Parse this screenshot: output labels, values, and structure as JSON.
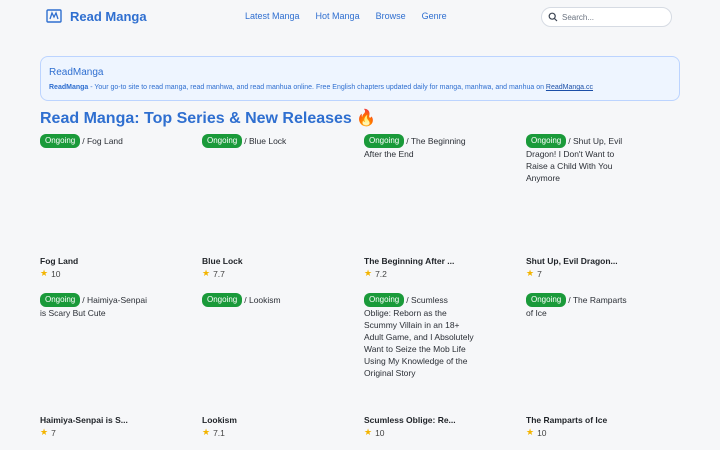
{
  "header": {
    "brand": "Read Manga",
    "nav": [
      "Latest Manga",
      "Hot Manga",
      "Browse",
      "Genre"
    ],
    "search_placeholder": "Search..."
  },
  "info": {
    "title": "ReadManga",
    "bold": "ReadManga",
    "text": " - Your go-to site to read manga, read manhwa, and read manhua online. Free English chapters updated daily for manga, manhwa, and manhua on ",
    "link": "ReadManga.cc"
  },
  "page_title": "Read Manga: Top Series & New Releases 🔥",
  "status_label": "Ongoing",
  "cards": [
    {
      "alt": "/ Fog Land",
      "name": "Fog Land",
      "rating": "10"
    },
    {
      "alt": "/ Blue Lock",
      "name": "Blue Lock",
      "rating": "7.7"
    },
    {
      "alt": "/ The Beginning After the End",
      "name": "The Beginning After ...",
      "rating": "7.2"
    },
    {
      "alt": "/ Shut Up, Evil Dragon! I Don't Want to Raise a Child With You Anymore",
      "name": "Shut Up, Evil Dragon...",
      "rating": "7"
    },
    {
      "alt": "/ Haimiya-Senpai is Scary But Cute",
      "name": "Haimiya-Senpai is S...",
      "rating": "7"
    },
    {
      "alt": "/ Lookism",
      "name": "Lookism",
      "rating": "7.1"
    },
    {
      "alt": "/ Scumless Oblige: Reborn as the Scummy Villain in an 18+ Adult Game, and I Absolutely Want to Seize the Mob Life Using My Knowledge of the Original Story",
      "name": "Scumless Oblige: Re...",
      "rating": "10"
    },
    {
      "alt": "/ The Ramparts of Ice",
      "name": "The Ramparts of Ice",
      "rating": "10"
    }
  ]
}
